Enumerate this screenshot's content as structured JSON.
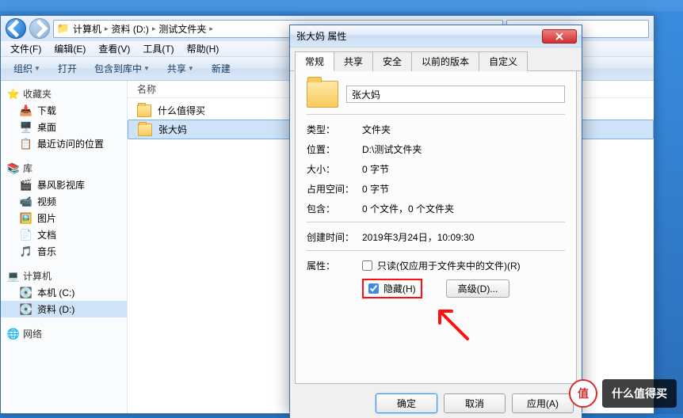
{
  "breadcrumb": {
    "root": "计算机",
    "drive": "资料 (D:)",
    "folder": "测试文件夹"
  },
  "menubar": {
    "file": "文件(F)",
    "edit": "编辑(E)",
    "view": "查看(V)",
    "tools": "工具(T)",
    "help": "帮助(H)"
  },
  "toolbar": {
    "organize": "组织",
    "open": "打开",
    "include": "包含到库中",
    "share": "共享",
    "new": "新建"
  },
  "sidebar": {
    "fav": {
      "header": "收藏夹",
      "items": [
        "下载",
        "桌面",
        "最近访问的位置"
      ]
    },
    "lib": {
      "header": "库",
      "items": [
        "暴风影视库",
        "视频",
        "图片",
        "文档",
        "音乐"
      ]
    },
    "comp": {
      "header": "计算机",
      "items": [
        "本机 (C:)",
        "资料 (D:)"
      ]
    },
    "net": {
      "header": "网络"
    }
  },
  "content": {
    "col_name": "名称",
    "rows": [
      "什么值得买",
      "张大妈"
    ]
  },
  "dialog": {
    "title": "张大妈 属性",
    "tabs": [
      "常规",
      "共享",
      "安全",
      "以前的版本",
      "自定义"
    ],
    "name_value": "张大妈",
    "rows": {
      "type_lbl": "类型：",
      "type_val": "文件夹",
      "loc_lbl": "位置：",
      "loc_val": "D:\\测试文件夹",
      "size_lbl": "大小：",
      "size_val": "0 字节",
      "disk_lbl": "占用空间：",
      "disk_val": "0 字节",
      "contains_lbl": "包含：",
      "contains_val": "0 个文件，0 个文件夹",
      "created_lbl": "创建时间：",
      "created_val": "2019年3月24日，10:09:30",
      "attr_lbl": "属性：",
      "readonly": "只读(仅应用于文件夹中的文件)(R)",
      "hidden": "隐藏(H)",
      "advanced": "高级(D)..."
    },
    "buttons": {
      "ok": "确定",
      "cancel": "取消",
      "apply": "应用(A)"
    }
  },
  "watermark": {
    "icon": "值",
    "text": "什么值得买"
  }
}
